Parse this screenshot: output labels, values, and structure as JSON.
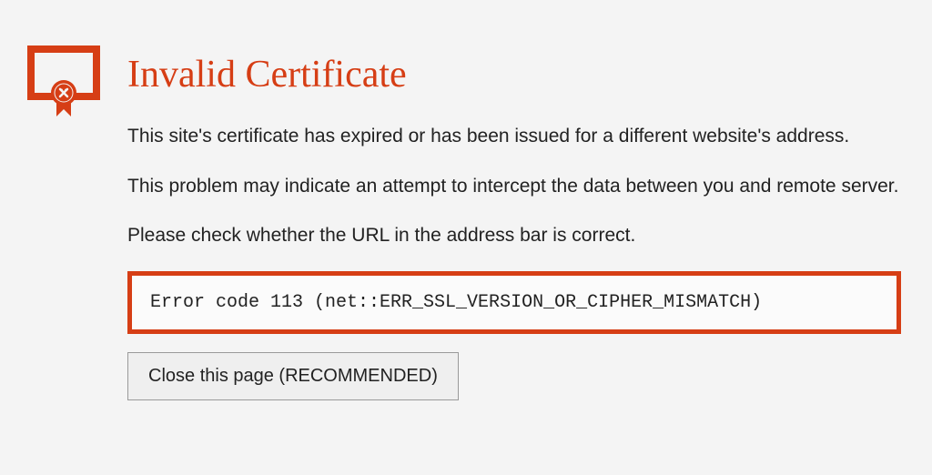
{
  "icon_name": "invalid-certificate-icon",
  "title": "Invalid Certificate",
  "paragraphs": [
    "This site's certificate has expired or has been issued for a different website's address.",
    "This problem may indicate an attempt to intercept the data between you and remote server.",
    "Please check whether the URL in the address bar is correct."
  ],
  "error_code": "Error code 113 (net::ERR_SSL_VERSION_OR_CIPHER_MISMATCH)",
  "close_button_label": "Close this page (RECOMMENDED)",
  "colors": {
    "accent": "#d63e15",
    "background": "#f4f4f4",
    "text": "#222222"
  }
}
